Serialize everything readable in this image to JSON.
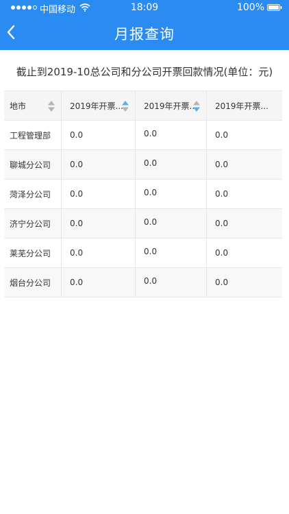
{
  "status": {
    "carrier": "中国移动",
    "time": "18:09",
    "battery": "100%"
  },
  "nav": {
    "title": "月报查询"
  },
  "subtitle": "截止到2019-10总公司和分公司开票回款情况(单位：元)",
  "table": {
    "headers": [
      "地市",
      "2019年开票...",
      "2019年开票...",
      "2019年开票..."
    ],
    "rows": [
      [
        "工程管理部",
        "0.0",
        "0.0",
        "0.0"
      ],
      [
        "聊城分公司",
        "0.0",
        "0.0",
        "0.0"
      ],
      [
        "菏泽分公司",
        "0.0",
        "0.0",
        "0.0"
      ],
      [
        "济宁分公司",
        "0.0",
        "0.0",
        "0.0"
      ],
      [
        "莱芜分公司",
        "0.0",
        "0.0",
        "0.0"
      ],
      [
        "烟台分公司",
        "0.0",
        "0.0",
        "0.0"
      ]
    ]
  },
  "colors": {
    "accent": "#2a8cf2",
    "sort_active": "#5aaef0",
    "sort_inactive": "#b5b5b5"
  }
}
